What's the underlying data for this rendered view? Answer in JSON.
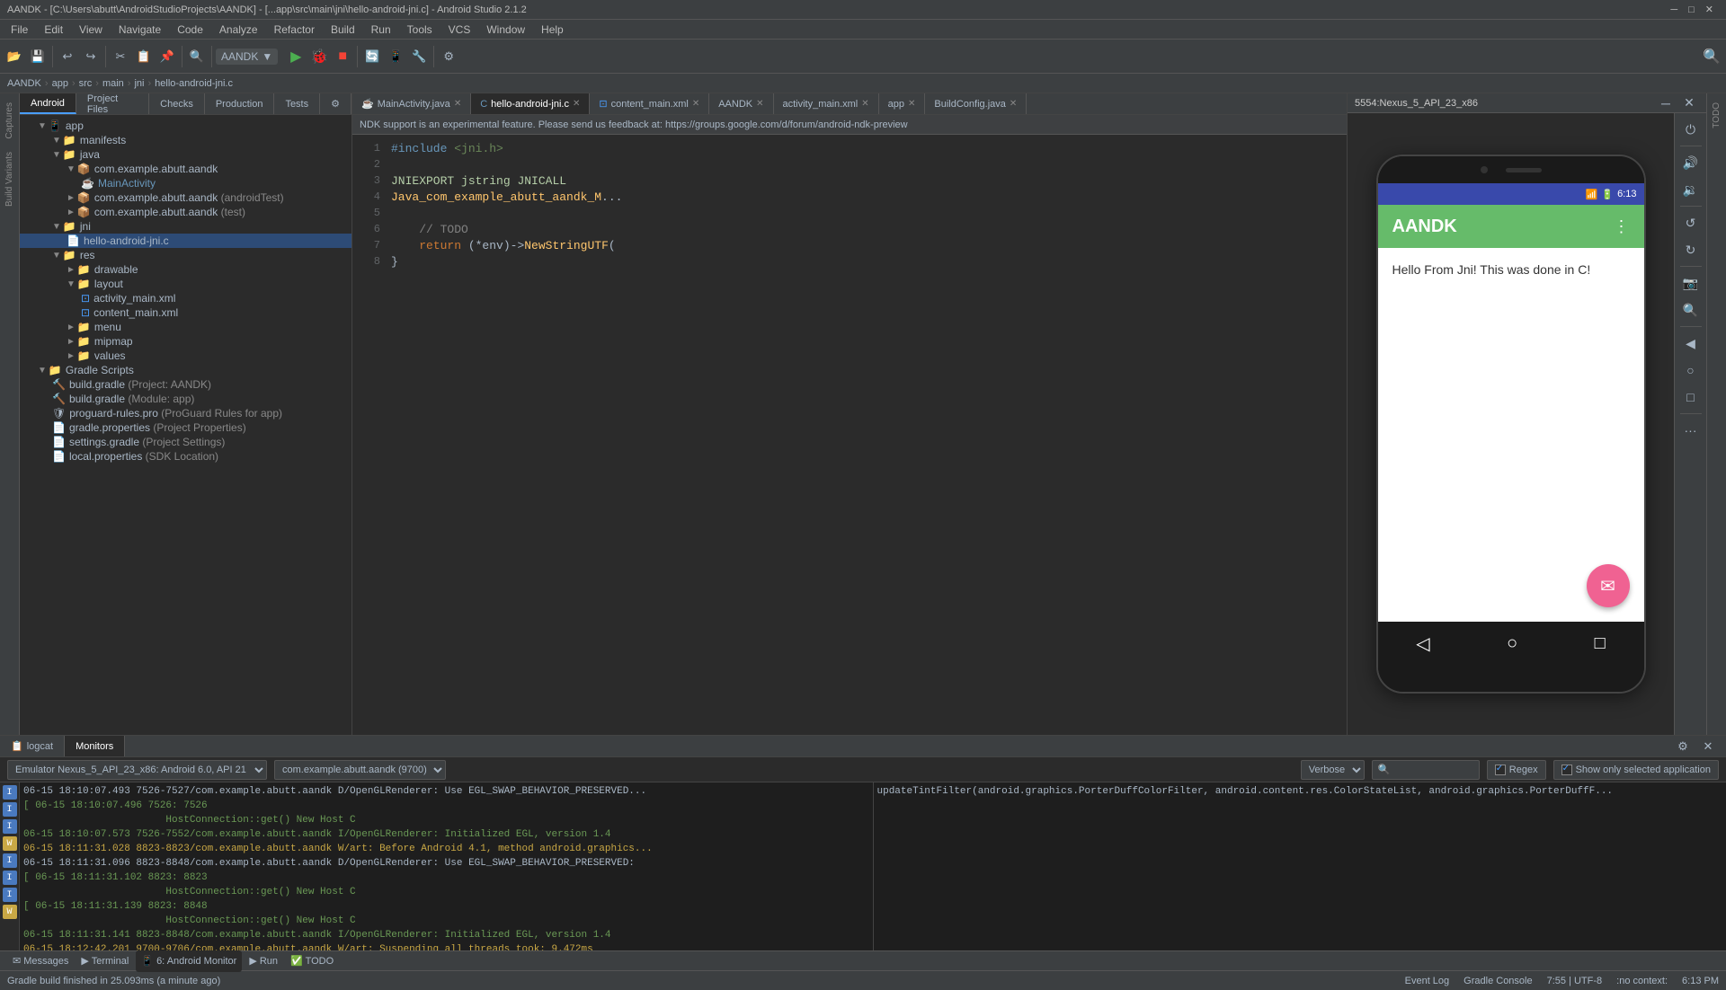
{
  "titlebar": {
    "title": "AANDK - [C:\\Users\\abutt\\AndroidStudioProjects\\AANDK] - [...app\\src\\main\\jni\\hello-android-jni.c] - Android Studio 2.1.2"
  },
  "menubar": {
    "items": [
      "File",
      "Edit",
      "View",
      "Navigate",
      "Code",
      "Analyze",
      "Refactor",
      "Build",
      "Run",
      "Tools",
      "VCS",
      "Window",
      "Help"
    ]
  },
  "toolbar": {
    "appname_label": "AANDK",
    "module_label": "app",
    "src_label": "src",
    "main_label": "main",
    "jni_label": "jni",
    "file_label": "hello-android-jni.c"
  },
  "project_tabs": {
    "items": [
      "Android",
      "Project Files",
      "Checks",
      "Production",
      "Tests"
    ]
  },
  "project_tree": {
    "items": [
      {
        "label": "manifests",
        "level": 2,
        "type": "folder",
        "arrow": "▼"
      },
      {
        "label": "java",
        "level": 2,
        "type": "folder",
        "arrow": "▼"
      },
      {
        "label": "com.example.abutt.aandk",
        "level": 3,
        "type": "package",
        "arrow": "▼"
      },
      {
        "label": "MainActivity",
        "level": 4,
        "type": "class",
        "icon": "☕"
      },
      {
        "label": "com.example.abutt.aandk (androidTest)",
        "level": 3,
        "type": "package",
        "arrow": "►"
      },
      {
        "label": "com.example.abutt.aandk (test)",
        "level": 3,
        "type": "package",
        "arrow": "►"
      },
      {
        "label": "jni",
        "level": 2,
        "type": "folder",
        "arrow": "▼"
      },
      {
        "label": "hello-android-jni.c",
        "level": 3,
        "type": "file",
        "selected": true
      },
      {
        "label": "res",
        "level": 2,
        "type": "folder",
        "arrow": "▼"
      },
      {
        "label": "drawable",
        "level": 3,
        "type": "folder",
        "arrow": "►"
      },
      {
        "label": "layout",
        "level": 3,
        "type": "folder",
        "arrow": "▼"
      },
      {
        "label": "activity_main.xml",
        "level": 4,
        "type": "xml"
      },
      {
        "label": "content_main.xml",
        "level": 4,
        "type": "xml"
      },
      {
        "label": "menu",
        "level": 3,
        "type": "folder",
        "arrow": "►"
      },
      {
        "label": "mipmap",
        "level": 3,
        "type": "folder",
        "arrow": "►"
      },
      {
        "label": "values",
        "level": 3,
        "type": "folder",
        "arrow": "►"
      },
      {
        "label": "Gradle Scripts",
        "level": 1,
        "type": "folder",
        "arrow": "▼"
      },
      {
        "label": "build.gradle (Project: AANDK)",
        "level": 2,
        "type": "gradle"
      },
      {
        "label": "build.gradle (Module: app)",
        "level": 2,
        "type": "gradle"
      },
      {
        "label": "proguard-rules.pro (ProGuard Rules for app)",
        "level": 2,
        "type": "proguard"
      },
      {
        "label": "gradle.properties (Project Properties)",
        "level": 2,
        "type": "gradle"
      },
      {
        "label": "settings.gradle (Project Settings)",
        "level": 2,
        "type": "gradle"
      },
      {
        "label": "local.properties (SDK Location)",
        "level": 2,
        "type": "gradle"
      }
    ]
  },
  "editor_tabs": {
    "items": [
      {
        "label": "MainActivity.java",
        "active": false
      },
      {
        "label": "hello-android-jni.c",
        "active": true
      },
      {
        "label": "content_main.xml",
        "active": false
      },
      {
        "label": "AANDK",
        "active": false
      },
      {
        "label": "activity_main.xml",
        "active": false
      },
      {
        "label": "app",
        "active": false
      },
      {
        "label": "BuildConfig.java",
        "active": false
      }
    ]
  },
  "ndk_bar": {
    "text": "NDK support is an experimental feature. Please send us feedback at: https://groups.google.com/d/forum/android-ndk-preview"
  },
  "code": {
    "lines": [
      {
        "num": "",
        "text": "#include <jni.h>"
      },
      {
        "num": "",
        "text": ""
      },
      {
        "num": "",
        "text": "JNIEXPORT jstring JNICALL"
      },
      {
        "num": "",
        "text": "Java_com_example_abutt_aandk_M..."
      },
      {
        "num": "",
        "text": ""
      },
      {
        "num": "",
        "text": "    // TODO"
      },
      {
        "num": "",
        "text": "    return (*env)->NewStringUTF("
      },
      {
        "num": "",
        "text": "}"
      }
    ]
  },
  "breadcrumb": {
    "items": [
      "AANDK",
      "app",
      "src",
      "main",
      "jni",
      "hello-android-jni.c"
    ]
  },
  "emulator": {
    "title": "5554:Nexus_5_API_23_x86",
    "status_time": "6:13",
    "app_name": "AANDK",
    "content_text": "Hello From Jni! This was done in C!",
    "controls": {
      "power": "⏻",
      "volume_up": "🔊",
      "volume_down": "🔉",
      "rotate": "↺",
      "screenshot": "📷",
      "zoom": "🔍",
      "back": "◀",
      "home": "⬤",
      "square": "■",
      "more": "···"
    }
  },
  "bottom_panel": {
    "tabs": [
      {
        "label": "logcat",
        "active": false,
        "icon": "📋"
      },
      {
        "label": "Monitors",
        "active": true
      },
      {
        "label": "",
        "active": false
      }
    ],
    "emulator_select": "Emulator Nexus_5_API_23_x86: Android 6.0, API 21",
    "package_select": "com.example.abutt.aandk (9700)",
    "verbose_label": "Verbose",
    "search_placeholder": "🔍",
    "regex_label": "Regex",
    "show_only_label": "Show only selected application",
    "log_lines": [
      {
        "text": "06-15 18:10:07.493 7526-7527/com.example.abutt.aandk D/OpenGLRenderer: Use EGL_SWAP_BEHAVIOR_PRESERVED...",
        "level": "d"
      },
      {
        "text": "[ 06-15 18:10:07.496  7526:  7526",
        "level": "i"
      },
      {
        "text": "                                                         HostConnection::get() New Host C",
        "level": "i"
      },
      {
        "text": "06-15 18:10:07.573 7526-7552/com.example.abutt.aandk I/OpenGLRenderer: Initialized EGL, version 1.4",
        "level": "i"
      },
      {
        "text": "06-15 18:11:31.028 8823-8823/com.example.abutt.aandk W/art: Before Android 4.1, method android.graphics...",
        "level": "w"
      },
      {
        "text": "06-15 18:11:31.096 8823-8848/com.example.abutt.aandk D/OpenGLRenderer: Use EGL_SWAP_BEHAVIOR_PRESERVED:",
        "level": "d"
      },
      {
        "text": "[ 06-15 18:11:31.102  8823:  8823",
        "level": "i"
      },
      {
        "text": "                                                         HostConnection::get() New Host C",
        "level": "i"
      },
      {
        "text": "[ 06-15 18:11:31.139  8823: 8848",
        "level": "i"
      },
      {
        "text": "                                                         HostConnection::get() New Host C",
        "level": "i"
      },
      {
        "text": "06-15 18:11:31.141 8823-8848/com.example.abutt.aandk I/OpenGLRenderer: Initialized EGL, version 1.4",
        "level": "i"
      },
      {
        "text": "06-15 18:12:42.201 9700-9706/com.example.abutt.aandk W/art: Suspending all threads took: 9.472ms",
        "level": "w"
      }
    ],
    "right_log_text": "updateTintFilter(android.graphics.PorterDuffColorFilter, android.content.res.ColorStateList, android.graphics.PorterDuffF..."
  },
  "status_bar_bottom": {
    "left": "Gradle build finished in 25.093ms (a minute ago)",
    "right_event_log": "Event Log",
    "right_gradle_console": "Gradle Console",
    "time": "6:13 PM",
    "line_col": "7:55 | UTF-8",
    "context": ":no context:"
  },
  "bottom_icons": [
    "Messages",
    "Terminal",
    "6: Android Monitor",
    "Run",
    "TODO"
  ],
  "left_panel_icons": [
    "Captures",
    "Build Variants"
  ],
  "right_panel_icons": []
}
